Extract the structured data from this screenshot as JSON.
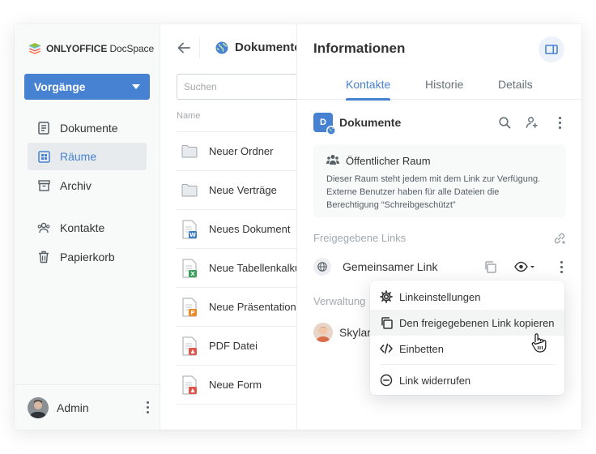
{
  "brand": {
    "name_bold": "ONLYOFFICE",
    "name_rest": " DocSpace"
  },
  "sidebar": {
    "actions_label": "Vorgänge",
    "items": [
      {
        "label": "Dokumente",
        "icon": "document-icon"
      },
      {
        "label": "Räume",
        "icon": "rooms-icon",
        "active": true
      },
      {
        "label": "Archiv",
        "icon": "archive-icon"
      },
      {
        "label": "Kontakte",
        "icon": "contacts-icon"
      },
      {
        "label": "Papierkorb",
        "icon": "trash-icon"
      }
    ],
    "user": "Admin"
  },
  "files": {
    "title": "Dokumente",
    "search_placeholder": "Suchen",
    "column_name": "Name",
    "rows": [
      {
        "name": "Neuer Ordner",
        "type": "folder"
      },
      {
        "name": "Neue Verträge",
        "type": "folder"
      },
      {
        "name": "Neues Dokument",
        "type": "docx"
      },
      {
        "name": "Neue Tabellenkalkulation",
        "type": "xlsx"
      },
      {
        "name": "Neue Präsentation",
        "type": "pptx"
      },
      {
        "name": "PDF Datei",
        "type": "pdf"
      },
      {
        "name": "Neue Form",
        "type": "pdf"
      }
    ]
  },
  "info": {
    "title": "Informationen",
    "tabs": [
      "Kontakte",
      "Historie",
      "Details"
    ],
    "active_tab": "Kontakte",
    "room": {
      "initial": "D",
      "name": "Dokumente"
    },
    "notice": {
      "title": "Öffentlicher Raum",
      "text": "Dieser Raum steht jedem mit dem Link zur Verfügung. Externe Benutzer haben für alle Dateien die Berechtigung “Schreibgeschützt”"
    },
    "shared_links_heading": "Freigegebene Links",
    "link_name": "Gemeinsamer Link",
    "admin_heading": "Verwaltung",
    "member_name": "Skylar"
  },
  "menu": {
    "items": [
      {
        "label": "Linkeinstellungen",
        "icon": "gear-icon"
      },
      {
        "label": "Den freigegebenen Link kopieren",
        "icon": "copy-icon",
        "hover": true
      },
      {
        "label": "Einbetten",
        "icon": "code-icon"
      },
      {
        "label": "Link widerrufen",
        "icon": "revoke-icon"
      }
    ]
  },
  "colors": {
    "accent": "#4781d1",
    "sidebar_bg": "#f8f9f9",
    "text": "#333333",
    "muted": "#a3a9ae"
  }
}
